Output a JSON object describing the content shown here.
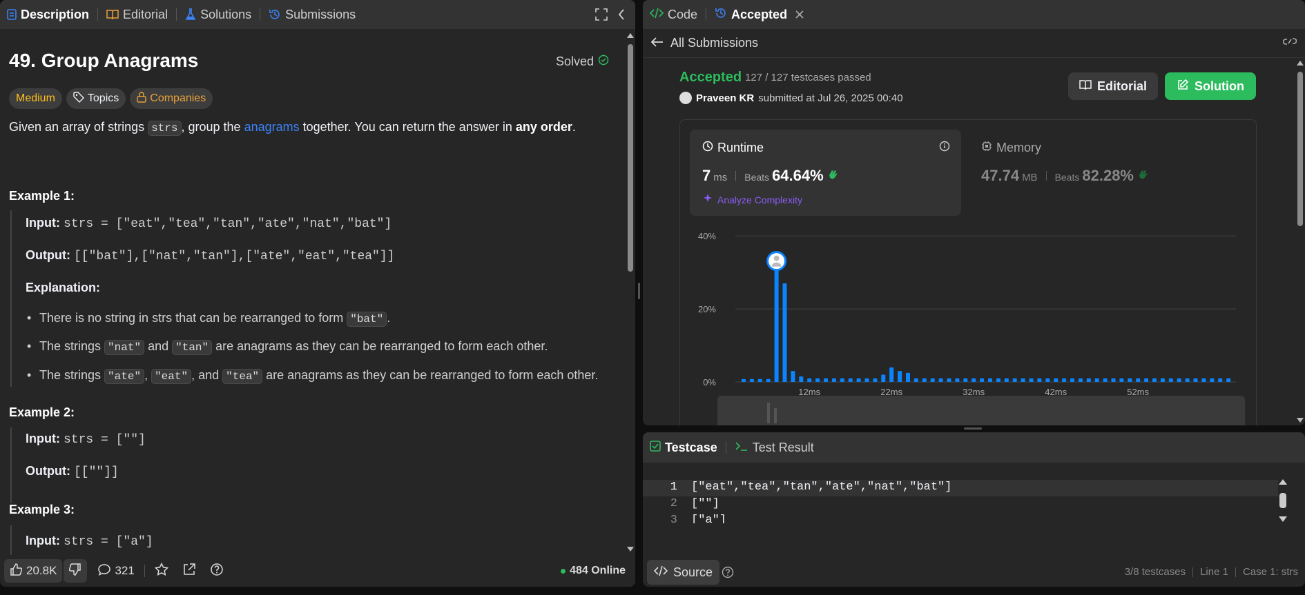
{
  "left_tabs": {
    "description": "Description",
    "editorial": "Editorial",
    "solutions": "Solutions",
    "submissions": "Submissions"
  },
  "problem": {
    "title": "49. Group Anagrams",
    "solved": "Solved",
    "difficulty": "Medium",
    "topics": "Topics",
    "companies": "Companies",
    "desc_a": "Given an array of strings ",
    "desc_code": "strs",
    "desc_b": ", group the ",
    "desc_link": "anagrams",
    "desc_c": " together. You can return the answer in ",
    "desc_bold": "any order",
    "desc_d": "."
  },
  "examples": {
    "ex1_title": "Example 1:",
    "input_label": "Input:",
    "output_label": "Output:",
    "explanation_label": "Explanation:",
    "ex1_input": "strs = [\"eat\",\"tea\",\"tan\",\"ate\",\"nat\",\"bat\"]",
    "ex1_output": "[[\"bat\"],[\"nat\",\"tan\"],[\"ate\",\"eat\",\"tea\"]]",
    "b1_a": "There is no string in strs that can be rearranged to form ",
    "b1_code": "\"bat\"",
    "b1_b": ".",
    "b2_a": "The strings ",
    "b2_c1": "\"nat\"",
    "b2_b": " and ",
    "b2_c2": "\"tan\"",
    "b2_c": " are anagrams as they can be rearranged to form each other.",
    "b3_a": "The strings ",
    "b3_c1": "\"ate\"",
    "b3_s1": ", ",
    "b3_c2": "\"eat\"",
    "b3_s2": ", and ",
    "b3_c3": "\"tea\"",
    "b3_b": " are anagrams as they can be rearranged to form each other.",
    "ex2_title": "Example 2:",
    "ex2_input": "strs = [\"\"]",
    "ex2_output": "[[\"\"]]",
    "ex3_title": "Example 3:",
    "ex3_input": "strs = [\"a\"]"
  },
  "left_footer": {
    "likes": "20.8K",
    "comments": "321",
    "online": "484 Online"
  },
  "right_tabs": {
    "code": "Code",
    "accepted": "Accepted"
  },
  "submission": {
    "back": "All Submissions",
    "status": "Accepted",
    "testcases": "127 / 127 testcases passed",
    "user": "Praveen KR",
    "submitted": "submitted at Jul 26, 2025 00:40",
    "editorial_btn": "Editorial",
    "solution_btn": "Solution",
    "runtime_label": "Runtime",
    "runtime_value": "7",
    "runtime_unit": "ms",
    "beats": "Beats",
    "runtime_beats": "64.64%",
    "analyze": "Analyze Complexity",
    "memory_label": "Memory",
    "memory_value": "47.74",
    "memory_unit": "MB",
    "memory_beats": "82.28%"
  },
  "chart_data": {
    "type": "bar",
    "y_ticks": [
      "40%",
      "20%",
      "0%"
    ],
    "x_ticks": [
      "12ms",
      "22ms",
      "32ms",
      "42ms",
      "52ms"
    ],
    "ylim": [
      0,
      40
    ],
    "values": [
      0.8,
      0.8,
      0.8,
      0.8,
      32,
      27,
      3,
      1.5,
      1,
      1,
      1,
      1,
      1,
      1,
      1,
      1,
      1,
      2,
      4,
      3,
      2.5,
      1,
      1,
      1,
      1,
      1,
      1,
      1,
      1,
      1,
      1,
      1,
      1,
      1,
      1,
      1,
      1,
      1,
      1,
      1,
      1,
      1,
      1,
      1,
      1,
      1,
      1,
      1,
      1,
      1,
      1,
      1,
      1,
      1,
      1,
      1,
      1,
      1,
      1,
      1
    ],
    "highlight_index": 4,
    "bar_color": "#0a84ff"
  },
  "testcase": {
    "tab1": "Testcase",
    "tab2": "Test Result",
    "lines": [
      {
        "n": "1",
        "t": "[\"eat\",\"tea\",\"tan\",\"ate\",\"nat\",\"bat\"]"
      },
      {
        "n": "2",
        "t": "[\"\"]"
      },
      {
        "n": "3",
        "t": "[\"a\"]"
      }
    ],
    "source": "Source",
    "status_a": "3/8 testcases",
    "status_b": "Line 1",
    "status_c": "Case 1: strs"
  }
}
